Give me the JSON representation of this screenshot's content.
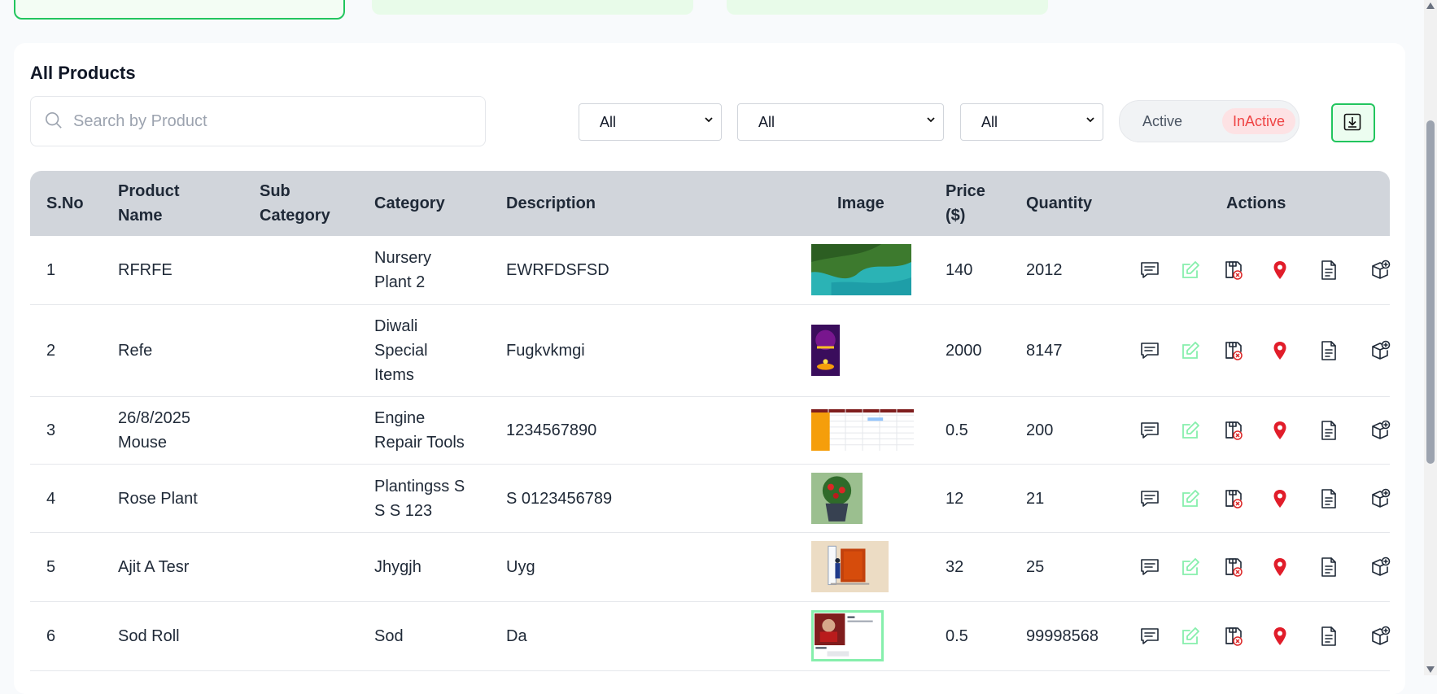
{
  "colors": {
    "accent_green": "#22c55e",
    "inactive_red": "#ef4444",
    "header_bg": "#d1d5db",
    "location_pin": "#e11d2a",
    "edit_icon": "#86efac"
  },
  "panel": {
    "title": "All Products"
  },
  "search": {
    "placeholder": "Search by Product",
    "value": ""
  },
  "filters": [
    {
      "selected": "All"
    },
    {
      "selected": "All"
    },
    {
      "selected": "All"
    }
  ],
  "status_toggle": {
    "active_label": "Active",
    "inactive_label": "InActive",
    "selected": "InActive"
  },
  "table": {
    "headers": {
      "sno": "S.No",
      "product_name_1": "Product",
      "product_name_2": "Name",
      "sub_category_1": "Sub",
      "sub_category_2": "Category",
      "category": "Category",
      "description": "Description",
      "image": "Image",
      "price_1": "Price",
      "price_2": "($)",
      "quantity": "Quantity",
      "actions": "Actions"
    },
    "action_icons": [
      "comment-icon",
      "edit-icon",
      "save-delete-icon",
      "location-pin-icon",
      "document-icon",
      "box-add-icon"
    ],
    "rows": [
      {
        "sno": "1",
        "name_1": "RFRFE",
        "name_2": "",
        "sub_category": "",
        "cat_1": "Nursery",
        "cat_2": "Plant 2",
        "cat_3": "",
        "description": "EWRFDSFSD",
        "image": "coastline-photo",
        "price": "140",
        "quantity": "2012"
      },
      {
        "sno": "2",
        "name_1": "Refe",
        "name_2": "",
        "sub_category": "",
        "cat_1": "Diwali",
        "cat_2": "Special",
        "cat_3": "Items",
        "description": "Fugkvkmgi",
        "image": "diwali-poster",
        "price": "2000",
        "quantity": "8147"
      },
      {
        "sno": "3",
        "name_1": "26/8/2025",
        "name_2": "Mouse",
        "sub_category": "",
        "cat_1": "Engine",
        "cat_2": "Repair Tools",
        "cat_3": "",
        "description": "1234567890",
        "image": "spreadsheet-screenshot",
        "price": "0.5",
        "quantity": "200"
      },
      {
        "sno": "4",
        "name_1": "Rose Plant",
        "name_2": "",
        "sub_category": "",
        "cat_1": "Plantingss S",
        "cat_2": "S S 123",
        "cat_3": "",
        "description": "S 0123456789",
        "image": "rose-plant-photo",
        "price": "12",
        "quantity": "21"
      },
      {
        "sno": "5",
        "name_1": "Ajit A Tesr",
        "name_2": "",
        "sub_category": "",
        "cat_1": "Jhygjh",
        "cat_2": "",
        "cat_3": "",
        "description": "Uyg",
        "image": "man-door-illustration",
        "price": "32",
        "quantity": "25"
      },
      {
        "sno": "6",
        "name_1": "Sod Roll",
        "name_2": "",
        "sub_category": "",
        "cat_1": "Sod",
        "cat_2": "",
        "cat_3": "",
        "description": "Da",
        "image": "profile-card-image",
        "price": "0.5",
        "quantity": "99998568"
      }
    ]
  }
}
